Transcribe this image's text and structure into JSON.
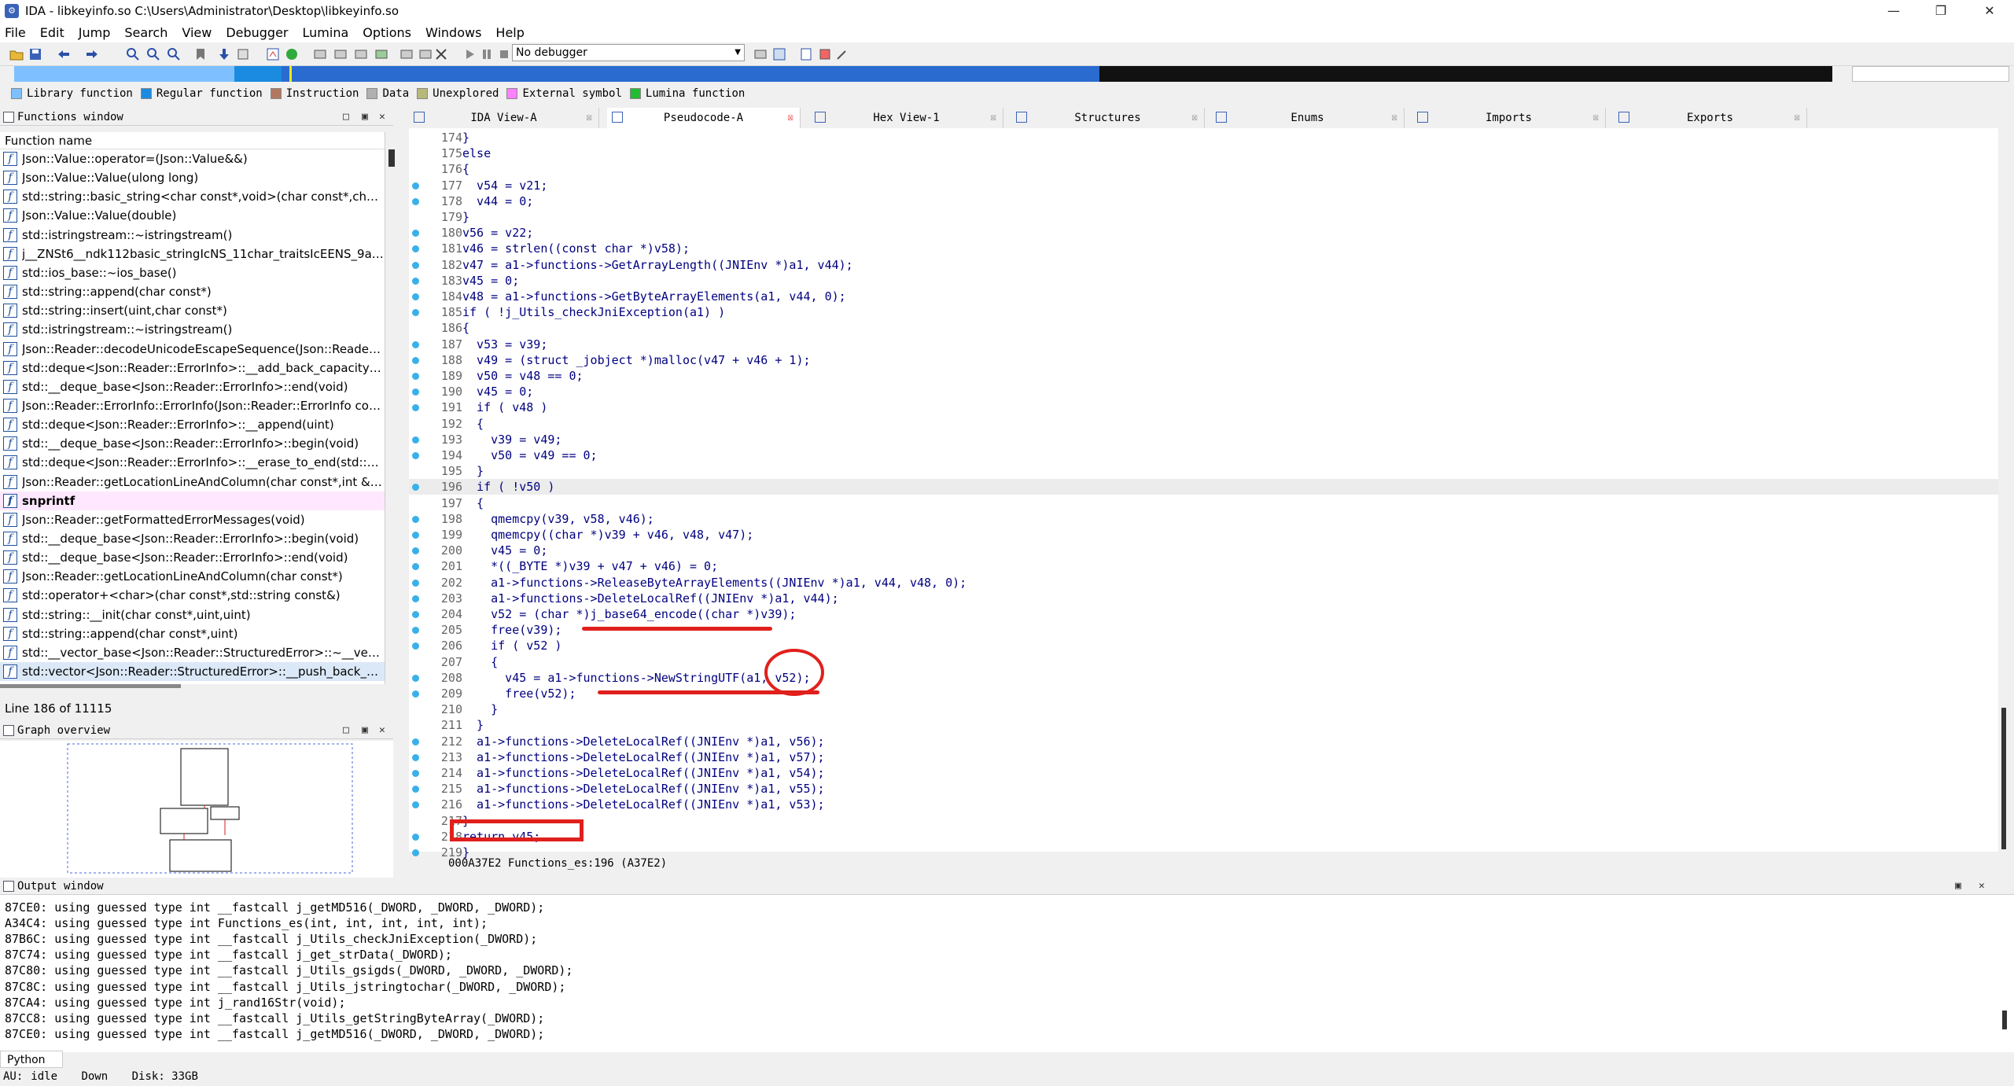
{
  "window": {
    "title": "IDA - libkeyinfo.so C:\\Users\\Administrator\\Desktop\\libkeyinfo.so",
    "minimize": "—",
    "maximize": "❐",
    "close": "✕"
  },
  "menu": [
    "File",
    "Edit",
    "Jump",
    "Search",
    "View",
    "Debugger",
    "Lumina",
    "Options",
    "Windows",
    "Help"
  ],
  "toolbar": {
    "debugger": "No debugger"
  },
  "legend": [
    {
      "label": "Library function",
      "color": "#7ec0ff"
    },
    {
      "label": "Regular function",
      "color": "#1a8be0"
    },
    {
      "label": "Instruction",
      "color": "#b07860"
    },
    {
      "label": "Data",
      "color": "#b0b0b0"
    },
    {
      "label": "Unexplored",
      "color": "#b8b87a"
    },
    {
      "label": "External symbol",
      "color": "#ff80ff"
    },
    {
      "label": "Lumina function",
      "color": "#22bb33"
    }
  ],
  "functions_window": {
    "title": "Functions window",
    "header": "Function name",
    "items": [
      "Json::Value::operator=(Json::Value&&)",
      "Json::Value::Value(ulong long)",
      "std::string::basic_string<char const*,void>(char const*,char c...",
      "Json::Value::Value(double)",
      "std::istringstream::~istringstream()",
      "j__ZNSt6__ndk112basic_stringIcNS_11char_traitsIcEENS_9allo...",
      "std::ios_base::~ios_base()",
      "std::string::append(char const*)",
      "std::string::insert(uint,char const*)",
      "std::istringstream::~istringstream()",
      "Json::Reader::decodeUnicodeEscapeSequence(Json::Reader::...",
      "std::deque<Json::Reader::ErrorInfo>::__add_back_capacity(v...",
      "std::__deque_base<Json::Reader::ErrorInfo>::end(void)",
      "Json::Reader::ErrorInfo::ErrorInfo(Json::Reader::ErrorInfo cons...",
      "std::deque<Json::Reader::ErrorInfo>::__append(uint)",
      "std::__deque_base<Json::Reader::ErrorInfo>::begin(void)",
      "std::deque<Json::Reader::ErrorInfo>::__erase_to_end(std::__d...",
      "Json::Reader::getLocationLineAndColumn(char const*,int &,i...",
      "snprintf",
      "Json::Reader::getFormattedErrorMessages(void)",
      "std::__deque_base<Json::Reader::ErrorInfo>::begin(void)",
      "std::__deque_base<Json::Reader::ErrorInfo>::end(void)",
      "Json::Reader::getLocationLineAndColumn(char const*)",
      "std::operator+<char>(char const*,std::string const&)",
      "std::string::__init(char const*,uint,uint)",
      "std::string::append(char const*,uint)",
      "std::__vector_base<Json::Reader::StructuredError>::~__vecto...",
      "std::vector<Json::Reader::StructuredError>::__push_back_slo..."
    ],
    "status": "Line 186 of 11115"
  },
  "graph_overview": {
    "title": "Graph overview"
  },
  "tabs": [
    {
      "label": "IDA View-A"
    },
    {
      "label": "Pseudocode-A"
    },
    {
      "label": "Hex View-1"
    },
    {
      "label": "Structures"
    },
    {
      "label": "Enums"
    },
    {
      "label": "Imports"
    },
    {
      "label": "Exports"
    }
  ],
  "code": [
    {
      "n": "174",
      "dot": false,
      "t": "}"
    },
    {
      "n": "175",
      "dot": false,
      "t": "else"
    },
    {
      "n": "176",
      "dot": false,
      "t": "{"
    },
    {
      "n": "177",
      "dot": true,
      "t": "  v54 = v21;"
    },
    {
      "n": "178",
      "dot": true,
      "t": "  v44 = 0;"
    },
    {
      "n": "179",
      "dot": false,
      "t": "}"
    },
    {
      "n": "180",
      "dot": true,
      "t": "v56 = v22;"
    },
    {
      "n": "181",
      "dot": true,
      "t": "v46 = strlen((const char *)v58);"
    },
    {
      "n": "182",
      "dot": true,
      "t": "v47 = a1->functions->GetArrayLength((JNIEnv *)a1, v44);"
    },
    {
      "n": "183",
      "dot": true,
      "t": "v45 = 0;"
    },
    {
      "n": "184",
      "dot": true,
      "t": "v48 = a1->functions->GetByteArrayElements(a1, v44, 0);"
    },
    {
      "n": "185",
      "dot": true,
      "t": "if ( !j_Utils_checkJniException(a1) )"
    },
    {
      "n": "186",
      "dot": false,
      "t": "{"
    },
    {
      "n": "187",
      "dot": true,
      "t": "  v53 = v39;"
    },
    {
      "n": "188",
      "dot": true,
      "t": "  v49 = (struct _jobject *)malloc(v47 + v46 + 1);"
    },
    {
      "n": "189",
      "dot": true,
      "t": "  v50 = v48 == 0;"
    },
    {
      "n": "190",
      "dot": true,
      "t": "  v45 = 0;"
    },
    {
      "n": "191",
      "dot": true,
      "t": "  if ( v48 )"
    },
    {
      "n": "192",
      "dot": false,
      "t": "  {"
    },
    {
      "n": "193",
      "dot": true,
      "t": "    v39 = v49;"
    },
    {
      "n": "194",
      "dot": true,
      "t": "    v50 = v49 == 0;"
    },
    {
      "n": "195",
      "dot": false,
      "t": "  }"
    },
    {
      "n": "196",
      "dot": true,
      "t": "  if ( !v50 )"
    },
    {
      "n": "197",
      "dot": false,
      "t": "  {"
    },
    {
      "n": "198",
      "dot": true,
      "t": "    qmemcpy(v39, v58, v46);"
    },
    {
      "n": "199",
      "dot": true,
      "t": "    qmemcpy((char *)v39 + v46, v48, v47);"
    },
    {
      "n": "200",
      "dot": true,
      "t": "    v45 = 0;"
    },
    {
      "n": "201",
      "dot": true,
      "t": "    *((_BYTE *)v39 + v47 + v46) = 0;"
    },
    {
      "n": "202",
      "dot": true,
      "t": "    a1->functions->ReleaseByteArrayElements((JNIEnv *)a1, v44, v48, 0);"
    },
    {
      "n": "203",
      "dot": true,
      "t": "    a1->functions->DeleteLocalRef((JNIEnv *)a1, v44);"
    },
    {
      "n": "204",
      "dot": true,
      "t": "    v52 = (char *)j_base64_encode((char *)v39);"
    },
    {
      "n": "205",
      "dot": true,
      "t": "    free(v39);"
    },
    {
      "n": "206",
      "dot": true,
      "t": "    if ( v52 )"
    },
    {
      "n": "207",
      "dot": false,
      "t": "    {"
    },
    {
      "n": "208",
      "dot": true,
      "t": "      v45 = a1->functions->NewStringUTF(a1, v52);"
    },
    {
      "n": "209",
      "dot": true,
      "t": "      free(v52);"
    },
    {
      "n": "210",
      "dot": false,
      "t": "    }"
    },
    {
      "n": "211",
      "dot": false,
      "t": "  }"
    },
    {
      "n": "212",
      "dot": true,
      "t": "  a1->functions->DeleteLocalRef((JNIEnv *)a1, v56);"
    },
    {
      "n": "213",
      "dot": true,
      "t": "  a1->functions->DeleteLocalRef((JNIEnv *)a1, v57);"
    },
    {
      "n": "214",
      "dot": true,
      "t": "  a1->functions->DeleteLocalRef((JNIEnv *)a1, v54);"
    },
    {
      "n": "215",
      "dot": true,
      "t": "  a1->functions->DeleteLocalRef((JNIEnv *)a1, v55);"
    },
    {
      "n": "216",
      "dot": true,
      "t": "  a1->functions->DeleteLocalRef((JNIEnv *)a1, v53);"
    },
    {
      "n": "217",
      "dot": false,
      "t": "}"
    },
    {
      "n": "218",
      "dot": true,
      "t": "return v45;"
    },
    {
      "n": "219",
      "dot": true,
      "t": "}"
    }
  ],
  "code_status": "000A37E2 Functions_es:196 (A37E2)",
  "output_window": {
    "title": "Output window",
    "lines": [
      "87CE0: using guessed type int __fastcall j_getMD516(_DWORD, _DWORD, _DWORD);",
      "A34C4: using guessed type int Functions_es(int, int, int, int, int);",
      "87B6C: using guessed type int __fastcall j_Utils_checkJniException(_DWORD);",
      "87C74: using guessed type int __fastcall j_get_strData(_DWORD);",
      "87C80: using guessed type int __fastcall j_Utils_gsigds(_DWORD, _DWORD, _DWORD);",
      "87C8C: using guessed type int __fastcall j_Utils_jstringtochar(_DWORD, _DWORD);",
      "87CA4: using guessed type int j_rand16Str(void);",
      "87CC8: using guessed type int __fastcall j_Utils_getStringByteArray(_DWORD);",
      "87CE0: using guessed type int __fastcall j_getMD516(_DWORD, _DWORD, _DWORD);"
    ]
  },
  "python_label": "Python",
  "status": {
    "au": "AU:",
    "state": "idle",
    "dir": "Down",
    "disk": "Disk: 33GB"
  }
}
